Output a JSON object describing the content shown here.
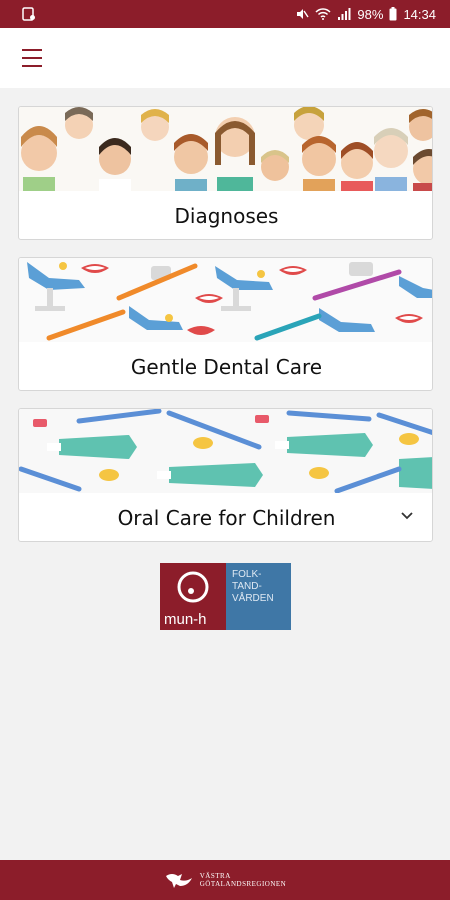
{
  "status_bar": {
    "battery_percent": "98%",
    "time": "14:34",
    "icons": [
      "notification-icon",
      "mute-icon",
      "wifi-icon",
      "signal-icon",
      "battery-icon"
    ]
  },
  "app_bar": {
    "menu_icon": "hamburger-icon"
  },
  "cards": [
    {
      "label": "Diagnoses",
      "image": "faces-illustration"
    },
    {
      "label": "Gentle Dental Care",
      "image": "dental-chair-illustration"
    },
    {
      "label": "Oral Care for Children",
      "image": "toothpaste-illustration",
      "icon": "chevron-down-icon"
    }
  ],
  "logo": {
    "name": "mun-h",
    "partner_lines": [
      "FOLK-",
      "TAND-",
      "VÅRDEN"
    ]
  },
  "footer": {
    "lines": [
      "VÄSTRA",
      "GÖTALANDSREGIONEN"
    ]
  },
  "colors": {
    "brand": "#8c1d2a",
    "partner_blue": "#3f77a6",
    "background": "#f2f2f2"
  }
}
